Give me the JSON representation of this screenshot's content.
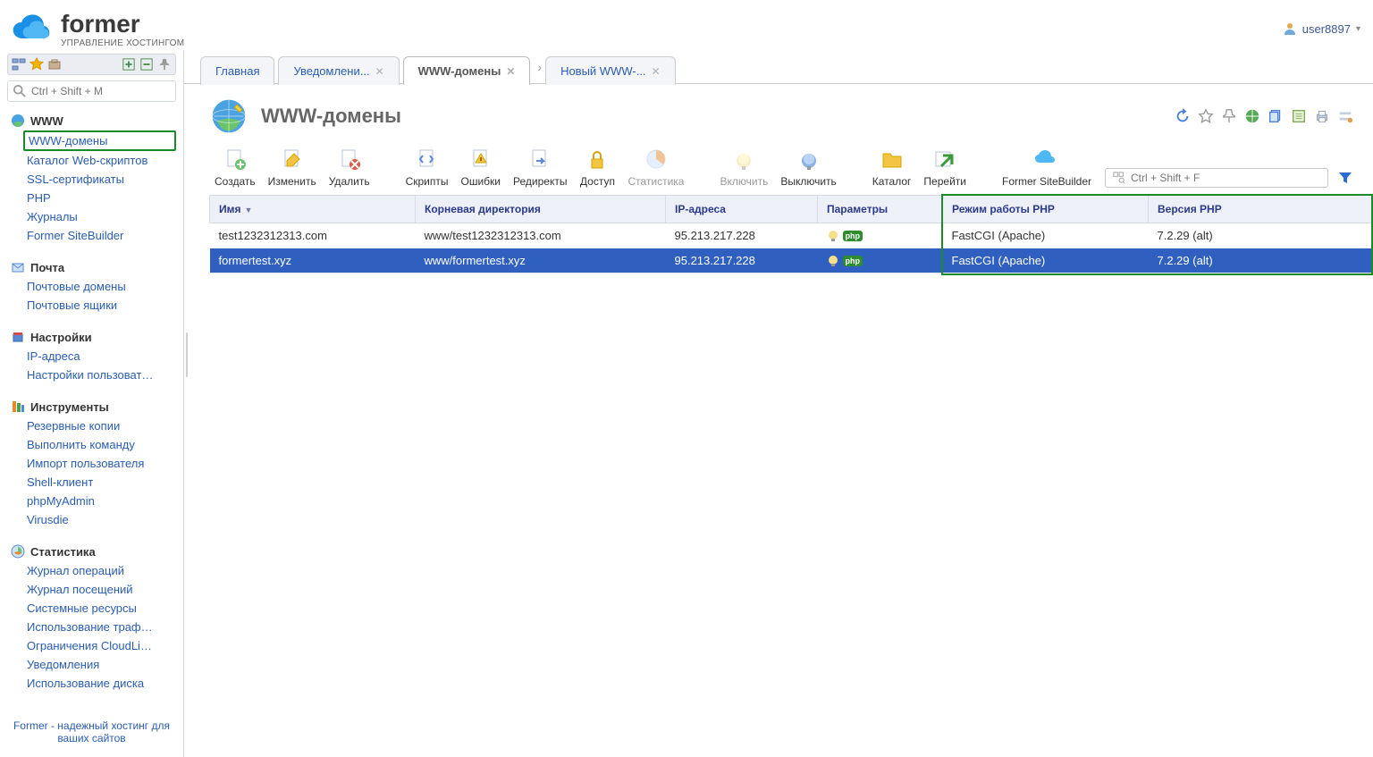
{
  "header": {
    "logo_title": "former",
    "logo_subtitle": "УПРАВЛЕНИЕ ХОСТИНГОМ",
    "user_label": "user8897"
  },
  "sidebar": {
    "search_placeholder": "Ctrl + Shift + M",
    "sections": [
      {
        "title": "WWW",
        "items": [
          "WWW-домены",
          "Каталог Web-скриптов",
          "SSL-сертификаты",
          "PHP",
          "Журналы",
          "Former SiteBuilder"
        ]
      },
      {
        "title": "Почта",
        "items": [
          "Почтовые домены",
          "Почтовые ящики"
        ]
      },
      {
        "title": "Настройки",
        "items": [
          "IP-адреса",
          "Настройки пользоват…"
        ]
      },
      {
        "title": "Инструменты",
        "items": [
          "Резервные копии",
          "Выполнить команду",
          "Импорт пользователя",
          "Shell-клиент",
          "phpMyAdmin",
          "Virusdie"
        ]
      },
      {
        "title": "Статистика",
        "items": [
          "Журнал операций",
          "Журнал посещений",
          "Системные ресурсы",
          "Использование траф…",
          "Ограничения CloudLi…",
          "Уведомления",
          "Использование диска"
        ]
      }
    ],
    "footer": "Former - надежный хостинг для ваших сайтов"
  },
  "tabs": [
    {
      "label": "Главная",
      "closable": false
    },
    {
      "label": "Уведомлени...",
      "closable": true
    },
    {
      "label": "WWW-домены",
      "closable": true,
      "active": true
    },
    {
      "label": "Новый WWW-...",
      "closable": true
    }
  ],
  "page": {
    "title": "WWW-домены",
    "quick_search_placeholder": "Ctrl + Shift + F"
  },
  "toolbar": [
    {
      "label": "Создать"
    },
    {
      "label": "Изменить"
    },
    {
      "label": "Удалить"
    },
    {
      "spacer": true
    },
    {
      "label": "Скрипты"
    },
    {
      "label": "Ошибки"
    },
    {
      "label": "Редиректы"
    },
    {
      "label": "Доступ"
    },
    {
      "label": "Статистика",
      "disabled": true
    },
    {
      "spacer": true
    },
    {
      "label": "Включить",
      "disabled": true
    },
    {
      "label": "Выключить"
    },
    {
      "spacer": true
    },
    {
      "label": "Каталог"
    },
    {
      "label": "Перейти"
    },
    {
      "spacer": true
    },
    {
      "label": "Former SiteBuilder"
    }
  ],
  "table": {
    "columns": [
      "Имя",
      "Корневая директория",
      "IP-адреса",
      "Параметры",
      "Режим работы PHP",
      "Версия PHP"
    ],
    "sort_col": 0,
    "rows": [
      {
        "name": "test1232312313.com",
        "root": "www/test1232312313.com",
        "ip": "95.213.217.228",
        "php_mode": "FastCGI (Apache)",
        "php_ver": "7.2.29 (alt)",
        "selected": false
      },
      {
        "name": "formertest.xyz",
        "root": "www/formertest.xyz",
        "ip": "95.213.217.228",
        "php_mode": "FastCGI (Apache)",
        "php_ver": "7.2.29 (alt)",
        "selected": true
      }
    ]
  }
}
